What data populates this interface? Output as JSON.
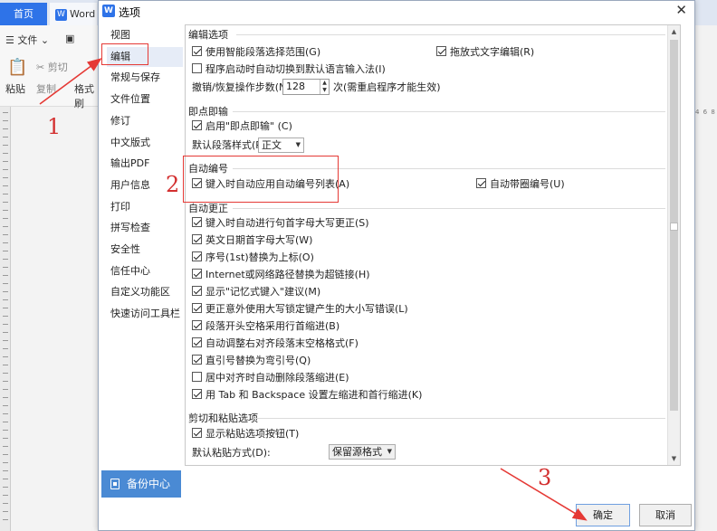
{
  "background": {
    "tabs": {
      "home": "首页",
      "word": "Word"
    },
    "toolbar": {
      "file": "文件",
      "paste": "粘贴",
      "cut": "剪切",
      "copy": "复制",
      "format": "格式刷"
    },
    "ruler_right": "4 6 8"
  },
  "dialog": {
    "title": "选项",
    "close_glyph": "✕",
    "nav": [
      "视图",
      "编辑",
      "常规与保存",
      "文件位置",
      "修订",
      "中文版式",
      "输出PDF",
      "用户信息",
      "打印",
      "拼写检查",
      "安全性",
      "信任中心",
      "自定义功能区",
      "快速访问工具栏"
    ],
    "active_nav": "编辑",
    "backup": "备份中心",
    "sections": {
      "edit": {
        "title": "编辑选项",
        "smart_select": "使用智能段落选择范围(G)",
        "drag_drop": "拖放式文字编辑(R)",
        "auto_ime": "程序启动时自动切换到默认语言输入法(I)",
        "undo_label": "撤销/恢复操作步数(N):",
        "undo_value": "128",
        "undo_note": "次(需重启程序才能生效)"
      },
      "click_type": {
        "title": "即点即输",
        "enable": "启用\"即点即输\" (C)",
        "default_style_label": "默认段落样式(P):",
        "default_style_value": "正文"
      },
      "auto_number": {
        "title": "自动编号",
        "auto_list": "键入时自动应用自动编号列表(A)",
        "circle_num": "自动带圈编号(U)"
      },
      "auto_correct": {
        "title": "自动更正",
        "items": [
          {
            "label": "键入时自动进行句首字母大写更正(S)",
            "checked": true
          },
          {
            "label": "英文日期首字母大写(W)",
            "checked": true
          },
          {
            "label": "序号(1st)替换为上标(O)",
            "checked": true
          },
          {
            "label": "Internet或网络路径替换为超链接(H)",
            "checked": true
          },
          {
            "label": "显示\"记忆式键入\"建议(M)",
            "checked": true
          },
          {
            "label": "更正意外使用大写锁定键产生的大小写错误(L)",
            "checked": true
          },
          {
            "label": "段落开头空格采用行首缩进(B)",
            "checked": true
          },
          {
            "label": "自动调整右对齐段落末空格格式(F)",
            "checked": true
          },
          {
            "label": "直引号替换为弯引号(Q)",
            "checked": true
          },
          {
            "label": "居中对齐时自动删除段落缩进(E)",
            "checked": false
          },
          {
            "label": "用 Tab 和 Backspace 设置左缩进和首行缩进(K)",
            "checked": true
          }
        ]
      },
      "cut_paste": {
        "title": "剪切和粘贴选项",
        "show_paste_btn": "显示粘贴选项按钮(T)",
        "default_paste_label": "默认粘贴方式(D):",
        "default_paste_value": "保留源格式"
      }
    },
    "ok": "确定",
    "cancel": "取消"
  },
  "annotations": {
    "n1": "1",
    "n2": "2",
    "n3": "3"
  },
  "colors": {
    "accent": "#2e73e8",
    "annotation": "#e53935",
    "backup_button": "#4a8ad4"
  }
}
